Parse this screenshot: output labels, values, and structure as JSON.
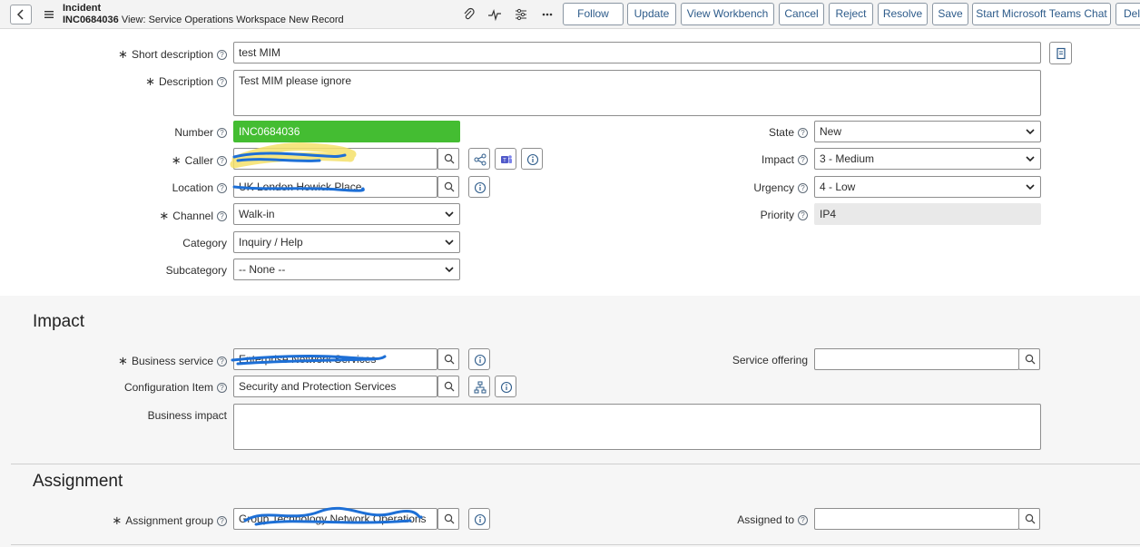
{
  "header": {
    "record_type": "Incident",
    "number": "INC0684036",
    "view_text": "View: Service Operations Workspace New Record",
    "buttons": {
      "follow": "Follow",
      "update": "Update",
      "view_workbench": "View Workbench",
      "cancel": "Cancel",
      "reject": "Reject",
      "resolve": "Resolve",
      "save": "Save",
      "teams_chat": "Start Microsoft Teams Chat",
      "delete": "Del"
    }
  },
  "form": {
    "short_description": {
      "label": "Short description",
      "value": "test MIM"
    },
    "description": {
      "label": "Description",
      "value": "Test MIM please ignore"
    },
    "number": {
      "label": "Number",
      "value": "INC0684036"
    },
    "caller": {
      "label": "Caller",
      "value": ""
    },
    "location": {
      "label": "Location",
      "value": "UK London Howick Place"
    },
    "channel": {
      "label": "Channel",
      "value": "Walk-in"
    },
    "category": {
      "label": "Category",
      "value": "Inquiry / Help"
    },
    "subcategory": {
      "label": "Subcategory",
      "value": "-- None --"
    },
    "state": {
      "label": "State",
      "value": "New"
    },
    "impact": {
      "label": "Impact",
      "value": "3 - Medium"
    },
    "urgency": {
      "label": "Urgency",
      "value": "4 - Low"
    },
    "priority": {
      "label": "Priority",
      "value": "IP4"
    }
  },
  "impact_section": {
    "title": "Impact",
    "business_service": {
      "label": "Business service",
      "value": "Enterprise Network Services"
    },
    "configuration_item": {
      "label": "Configuration Item",
      "value": "Security and Protection Services"
    },
    "business_impact": {
      "label": "Business impact",
      "value": ""
    },
    "service_offering": {
      "label": "Service offering",
      "value": ""
    }
  },
  "assignment_section": {
    "title": "Assignment",
    "assignment_group": {
      "label": "Assignment group",
      "value": "Group Technology Network Operations"
    },
    "assigned_to": {
      "label": "Assigned to",
      "value": ""
    }
  },
  "colors": {
    "number_field_bg": "#44bd32",
    "button_text": "#2d5b8a",
    "redaction_blue": "#1d6fd6",
    "highlight_yellow": "#f5e06a"
  }
}
